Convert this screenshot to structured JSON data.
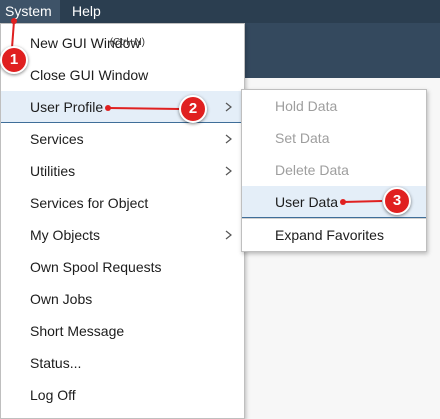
{
  "menubar": {
    "system_label": "System",
    "help_label": "Help"
  },
  "system_menu": {
    "items": [
      {
        "label": "New GUI Window",
        "accelerator": "(Ctrl+N)"
      },
      {
        "label": "Close GUI Window"
      },
      {
        "label": "User Profile"
      },
      {
        "label": "Services"
      },
      {
        "label": "Utilities"
      },
      {
        "label": "Services for Object"
      },
      {
        "label": "My Objects"
      },
      {
        "label": "Own Spool Requests"
      },
      {
        "label": "Own Jobs"
      },
      {
        "label": "Short Message"
      },
      {
        "label": "Status..."
      },
      {
        "label": "Log Off"
      }
    ]
  },
  "user_profile_submenu": {
    "items": [
      {
        "label": "Hold Data",
        "enabled": false
      },
      {
        "label": "Set Data",
        "enabled": false
      },
      {
        "label": "Delete Data",
        "enabled": false
      },
      {
        "label": "User Data",
        "enabled": true
      },
      {
        "label": "Expand Favorites",
        "enabled": true
      }
    ]
  },
  "callouts": {
    "step1": "1",
    "step2": "2",
    "step3": "3"
  },
  "colors": {
    "menubar": "#2b3e50",
    "highlight": "#e4eef8",
    "callout": "#e02020"
  }
}
